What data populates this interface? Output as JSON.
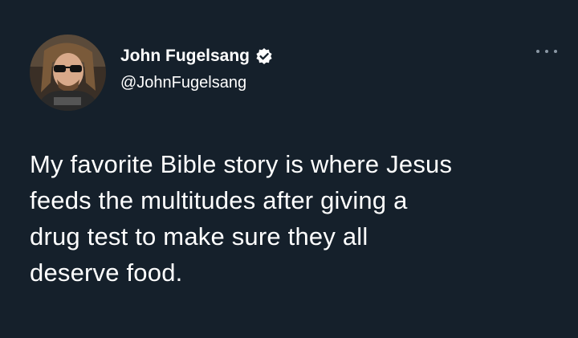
{
  "user": {
    "display_name": "John Fugelsang",
    "handle": "@JohnFugelsang",
    "avatar_icon": "user-avatar",
    "verified_icon": "verified-badge-icon"
  },
  "more_icon": "more-options-icon",
  "tweet": {
    "text": "My favorite Bible story is where Jesus\nfeeds the multitudes after giving a\ndrug test to make sure they all\ndeserve food."
  },
  "colors": {
    "background": "#15202b",
    "text": "#ffffff",
    "muted": "#8b98a5"
  }
}
